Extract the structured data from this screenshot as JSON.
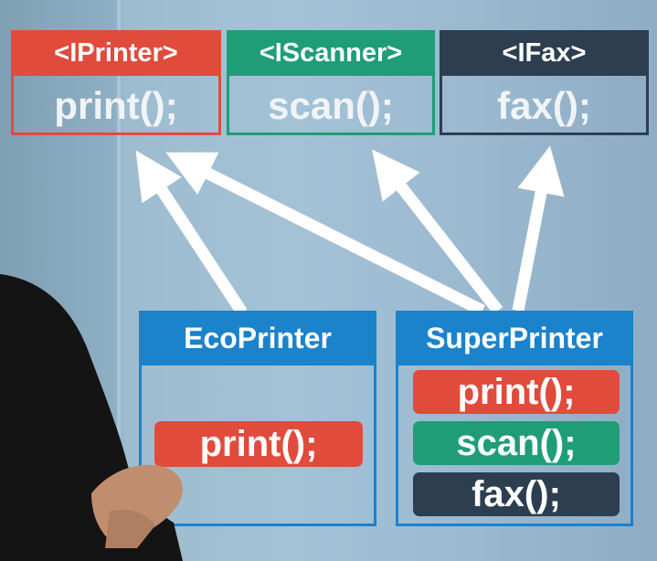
{
  "interfaces": [
    {
      "title": "<IPrinter>",
      "method": "print();",
      "color": "#e04b3c"
    },
    {
      "title": "<IScanner>",
      "method": "scan();",
      "color": "#1f9d77"
    },
    {
      "title": "<IFax>",
      "method": "fax();",
      "color": "#2d3e50"
    }
  ],
  "classes": [
    {
      "title": "EcoPrinter",
      "color": "#1b82cc",
      "methods": [
        {
          "label": "print();",
          "color": "#e04b3c"
        }
      ]
    },
    {
      "title": "SuperPrinter",
      "color": "#1b82cc",
      "methods": [
        {
          "label": "print();",
          "color": "#e04b3c"
        },
        {
          "label": "scan();",
          "color": "#1f9d77"
        },
        {
          "label": "fax();",
          "color": "#2d3e50"
        }
      ]
    }
  ],
  "arrow_color": "#ffffff"
}
